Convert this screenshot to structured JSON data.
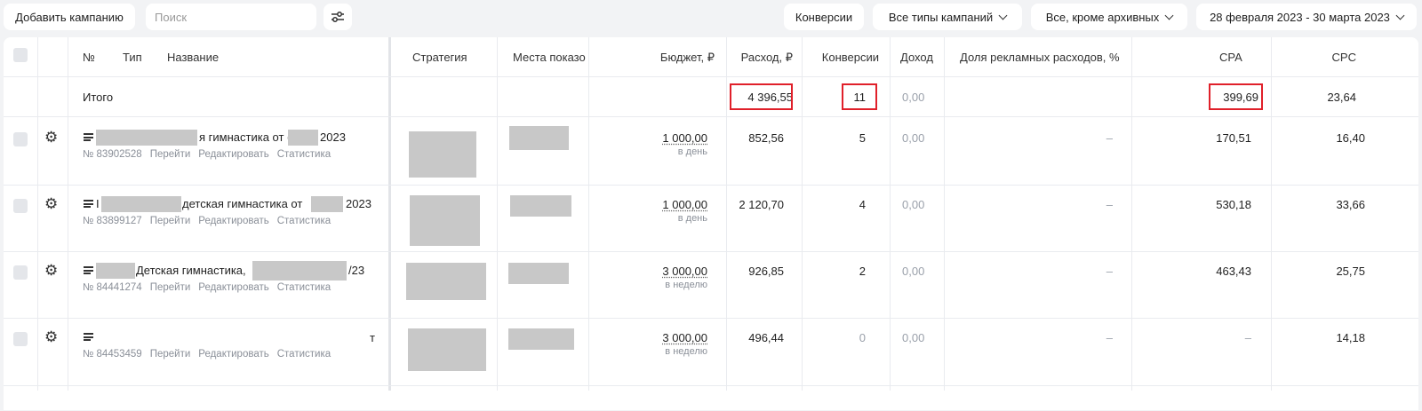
{
  "toolbar": {
    "add_campaign": "Добавить кампанию",
    "search_placeholder": "Поиск",
    "conversions": "Конверсии",
    "campaign_types": "Все типы кампаний",
    "archive_filter": "Все, кроме архивных",
    "date_range": "28 февраля 2023 - 30 марта 2023"
  },
  "columns": {
    "num": "№",
    "type": "Тип",
    "name": "Название",
    "strategy": "Стратегия",
    "placements": "Места показо",
    "budget": "Бюджет, ₽",
    "spend": "Расход, ₽",
    "conversions": "Конверсии",
    "revenue": "Доход",
    "ad_share": "Доля рекламных расходов, %",
    "cpa": "CPA",
    "cpc": "CPC"
  },
  "total": {
    "label": "Итого",
    "spend": "4 396,55",
    "conversions": "11",
    "revenue": "0,00",
    "cpa": "399,69",
    "cpc": "23,64"
  },
  "link_labels": {
    "go": "Перейти",
    "edit": "Редактировать",
    "stats": "Статистика"
  },
  "campaigns": [
    {
      "name_a": "",
      "name_b": "я гимнастика от (",
      "name_c": "2023",
      "id": "№ 83902528",
      "budget": "1 000,00",
      "period": "в день",
      "spend": "852,56",
      "conversions": "5",
      "revenue": "0,00",
      "ad_share": "–",
      "cpa": "170,51",
      "cpc": "16,40"
    },
    {
      "name_a": "I",
      "name_b": "детская гимнастика от",
      "name_c": "2023",
      "id": "№ 83899127",
      "budget": "1 000,00",
      "period": "в день",
      "spend": "2 120,70",
      "conversions": "4",
      "revenue": "0,00",
      "ad_share": "–",
      "cpa": "530,18",
      "cpc": "33,66"
    },
    {
      "name_a": "",
      "name_b": "Детская гимнастика,",
      "name_c": "/23",
      "id": "№ 84441274",
      "budget": "3 000,00",
      "period": "в неделю",
      "spend": "926,85",
      "conversions": "2",
      "revenue": "0,00",
      "ad_share": "–",
      "cpa": "463,43",
      "cpc": "25,75"
    },
    {
      "name_a": "",
      "name_b": "",
      "name_c": "т",
      "id": "№ 84453459",
      "budget": "3 000,00",
      "period": "в неделю",
      "spend": "496,44",
      "conversions": "0",
      "revenue": "0,00",
      "ad_share": "–",
      "cpa": "–",
      "cpc": "14,18"
    }
  ],
  "icons": {
    "settings": "gear-icon",
    "filter": "sliders-icon",
    "type": "text-campaign-icon"
  },
  "colors": {
    "highlight": "#e0202a",
    "bg": "#f2f3f5"
  }
}
